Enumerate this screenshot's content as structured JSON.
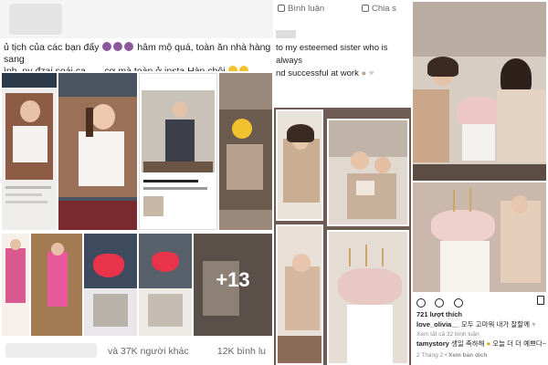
{
  "facebook": {
    "caption_line1": "ủ tịch của các bạn đấy",
    "caption_line1_after": "hâm mộ quá, toàn ăn nhà hàng sang",
    "caption_line2": "ình, ny đzai soái ca ..... cơ mà toàn ở insta Hàn chôi",
    "more_photos_count": "+13",
    "reactions_text": "và 37K người khác",
    "comments_text": "12K bình lu"
  },
  "instagram": {
    "topbar_comment": "Bình luận",
    "topbar_share": "Chia s",
    "story_caption_line1": "to my esteemed sister who is always",
    "story_caption_line2": "nd successful at work",
    "likes": "721 lượt thích",
    "caption_user": "love_olivia__",
    "caption_text": "모두 고마워 내가 잘할께",
    "view_comments": "Xem tất cả 32 bình luận",
    "comment_user": "tamystory",
    "comment_text": "생일 축하해 ",
    "comment_tail": "오늘 더 더 예쁘다~",
    "time": "2 Tháng 2",
    "translate": "Xem bản dịch"
  },
  "colors": {
    "story_bg": "#6e5b53",
    "facebook_muted": "#65676b",
    "instagram_text": "#262626"
  },
  "icons": [
    "comment-icon",
    "share-icon",
    "like-icon",
    "send-icon",
    "bookmark-icon"
  ]
}
